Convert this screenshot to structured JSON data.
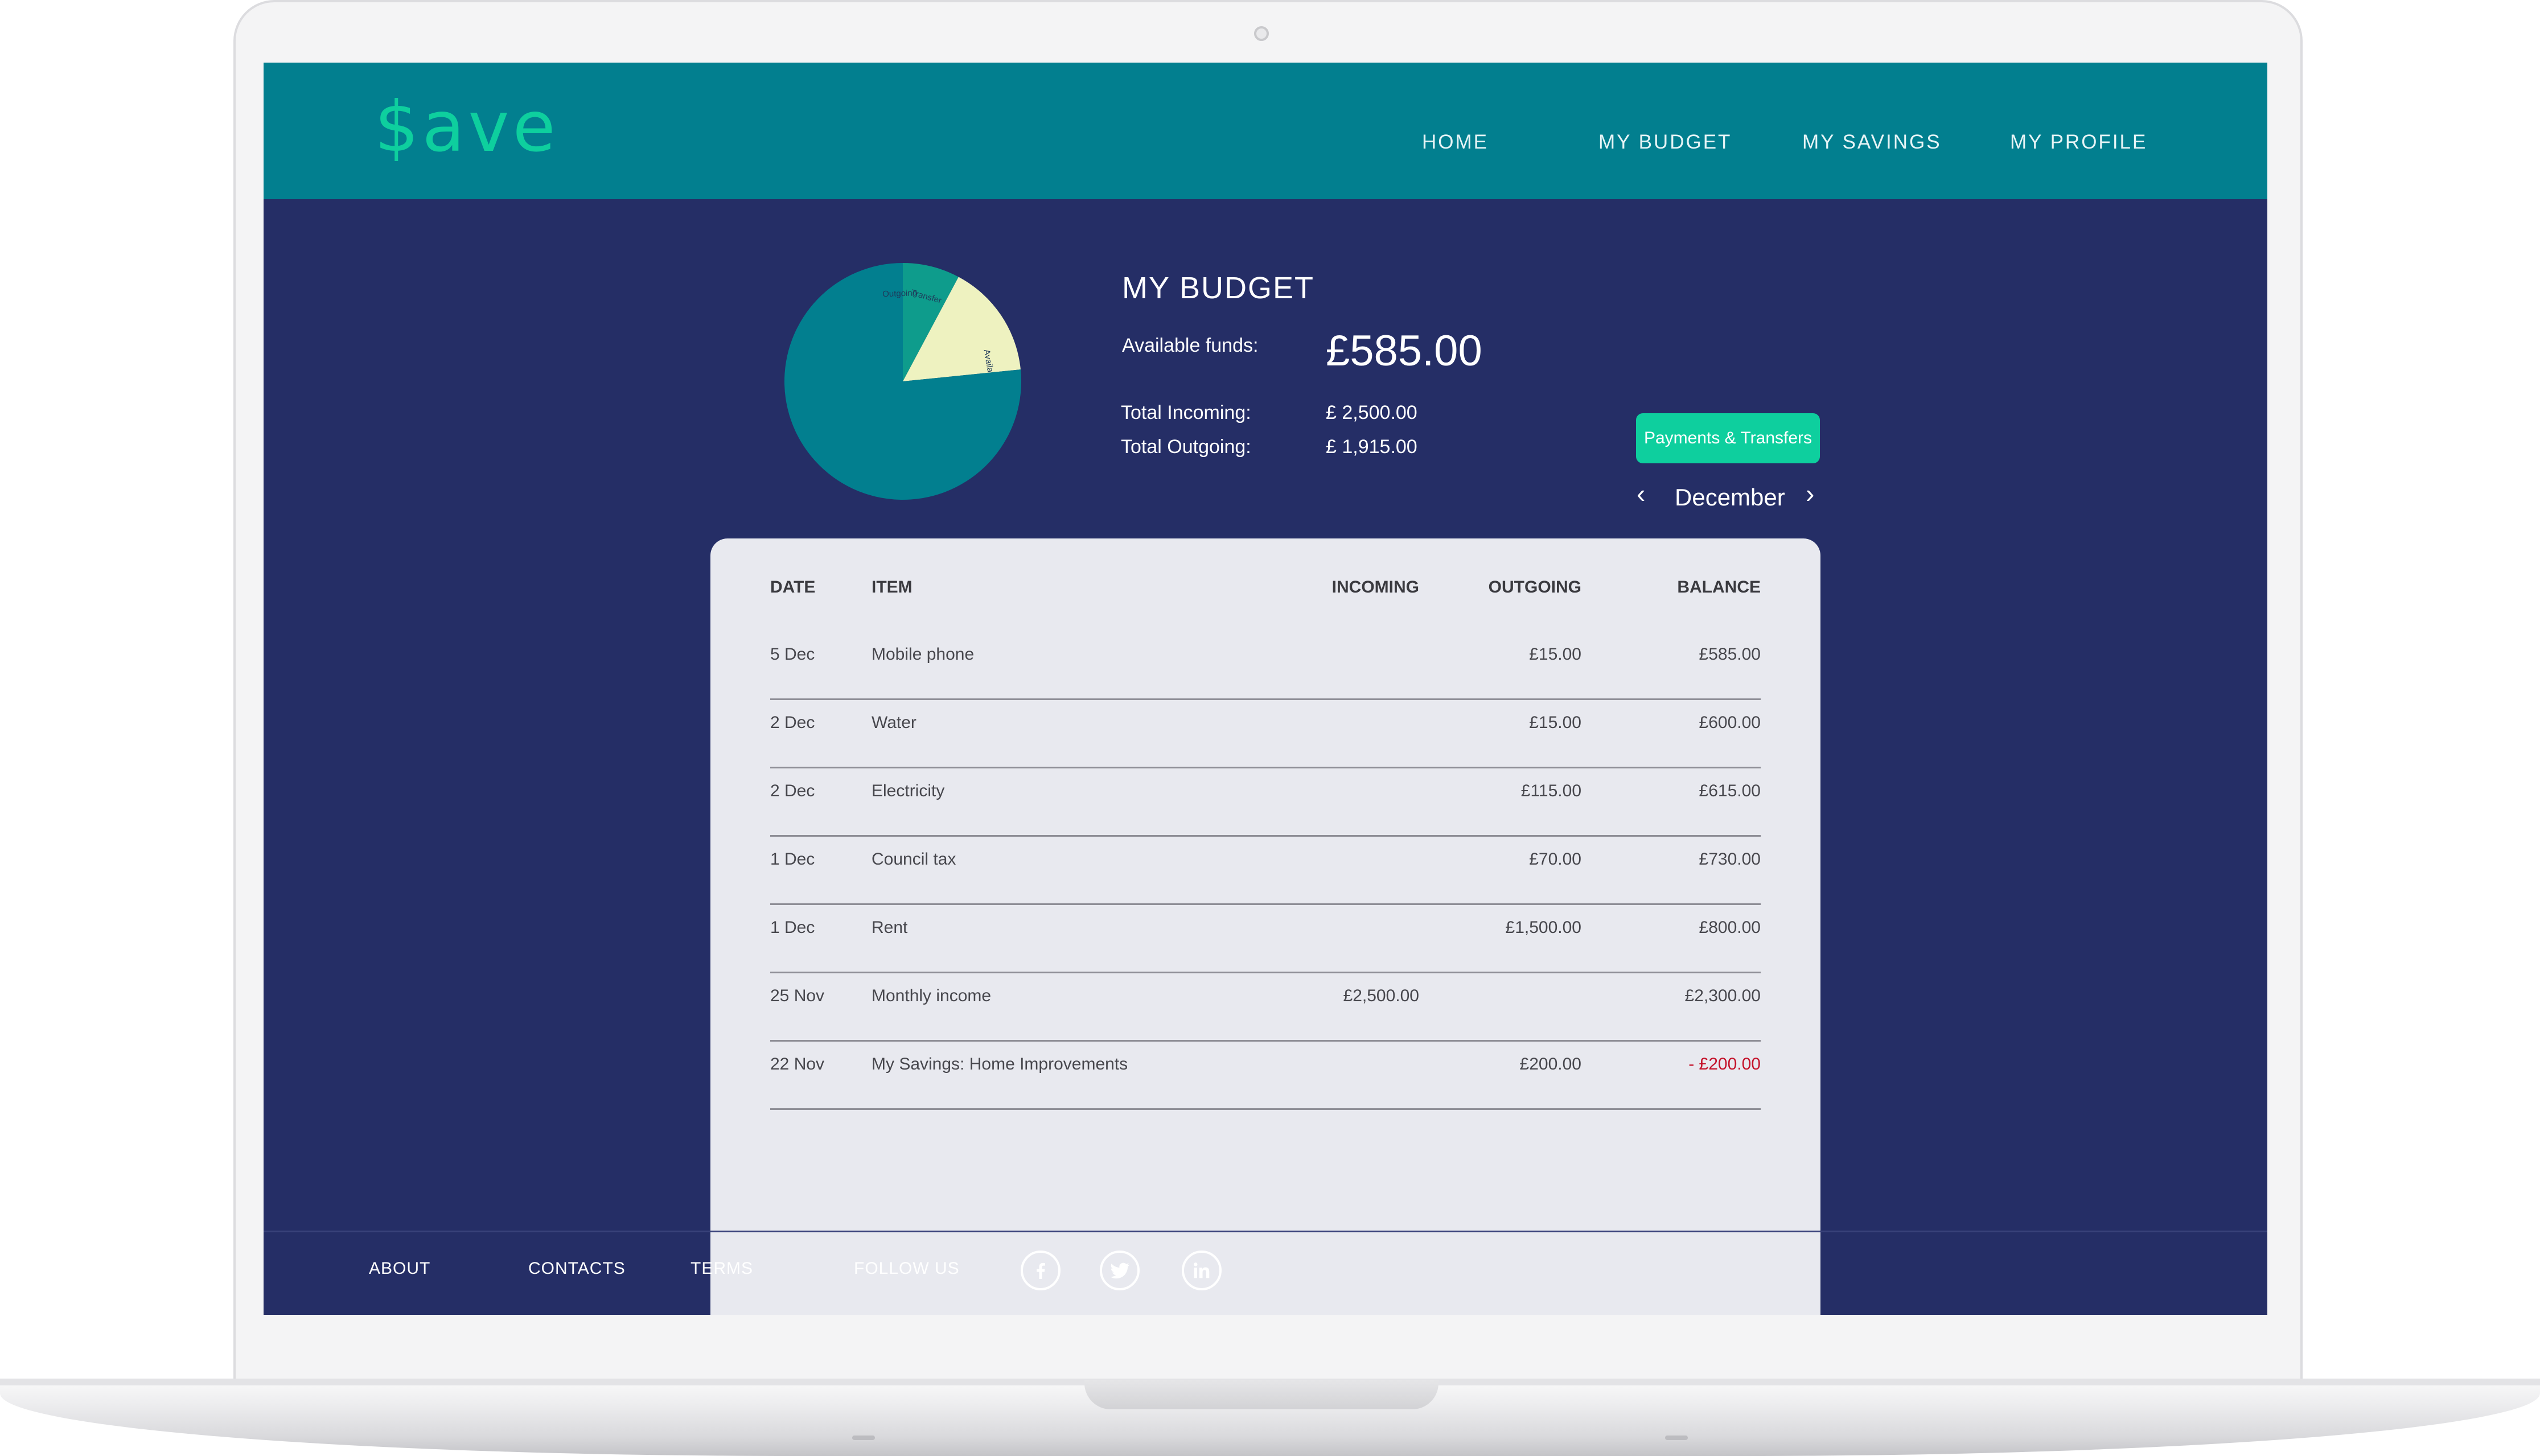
{
  "app": {
    "logo": "$ave"
  },
  "nav": {
    "home": "HOME",
    "budget": "MY BUDGET",
    "savings": "MY SAVINGS",
    "profile": "MY PROFILE"
  },
  "budget": {
    "title": "MY BUDGET",
    "available_label": "Available funds:",
    "available_value": "£585.00",
    "incoming_label": "Total Incoming:",
    "incoming_value": "£ 2,500.00",
    "outgoing_label": "Total Outgoing:",
    "outgoing_value": "£ 1,915.00",
    "payments_button": "Payments & Transfers",
    "month": "December"
  },
  "chart_data": {
    "type": "pie",
    "slices": [
      {
        "label": "Outgoing",
        "value": 76.6,
        "color": "#027f8f"
      },
      {
        "label": "Transfer",
        "value": 7.8,
        "color": "#0e9c8c"
      },
      {
        "label": "Available",
        "value": 15.6,
        "color": "#eef2c0"
      }
    ]
  },
  "table": {
    "headers": {
      "date": "DATE",
      "item": "ITEM",
      "incoming": "INCOMING",
      "outgoing": "OUTGOING",
      "balance": "BALANCE"
    },
    "rows": [
      {
        "date": "5 Dec",
        "item": "Mobile phone",
        "incoming": "",
        "outgoing": "£15.00",
        "balance": "£585.00"
      },
      {
        "date": "2 Dec",
        "item": "Water",
        "incoming": "",
        "outgoing": "£15.00",
        "balance": "£600.00"
      },
      {
        "date": "2 Dec",
        "item": "Electricity",
        "incoming": "",
        "outgoing": "£115.00",
        "balance": "£615.00"
      },
      {
        "date": "1 Dec",
        "item": "Council tax",
        "incoming": "",
        "outgoing": "£70.00",
        "balance": "£730.00"
      },
      {
        "date": "1 Dec",
        "item": "Rent",
        "incoming": "",
        "outgoing": "£1,500.00",
        "balance": "£800.00"
      },
      {
        "date": "25 Nov",
        "item": "Monthly income",
        "incoming": "£2,500.00",
        "outgoing": "",
        "balance": "£2,300.00"
      },
      {
        "date": "22 Nov",
        "item": "My Savings: Home Improvements",
        "incoming": "",
        "outgoing": "£200.00",
        "balance": "- £200.00"
      }
    ]
  },
  "footer": {
    "about": "ABOUT",
    "contacts": "CONTACTS",
    "terms": "TERMS",
    "follow": "FOLLOW US"
  },
  "social_icons": [
    "facebook-icon",
    "twitter-icon",
    "linkedin-icon"
  ],
  "colors": {
    "header": "#027f8f",
    "body": "#252e66",
    "accent": "#0ecf9e",
    "negative": "#c4122a"
  }
}
